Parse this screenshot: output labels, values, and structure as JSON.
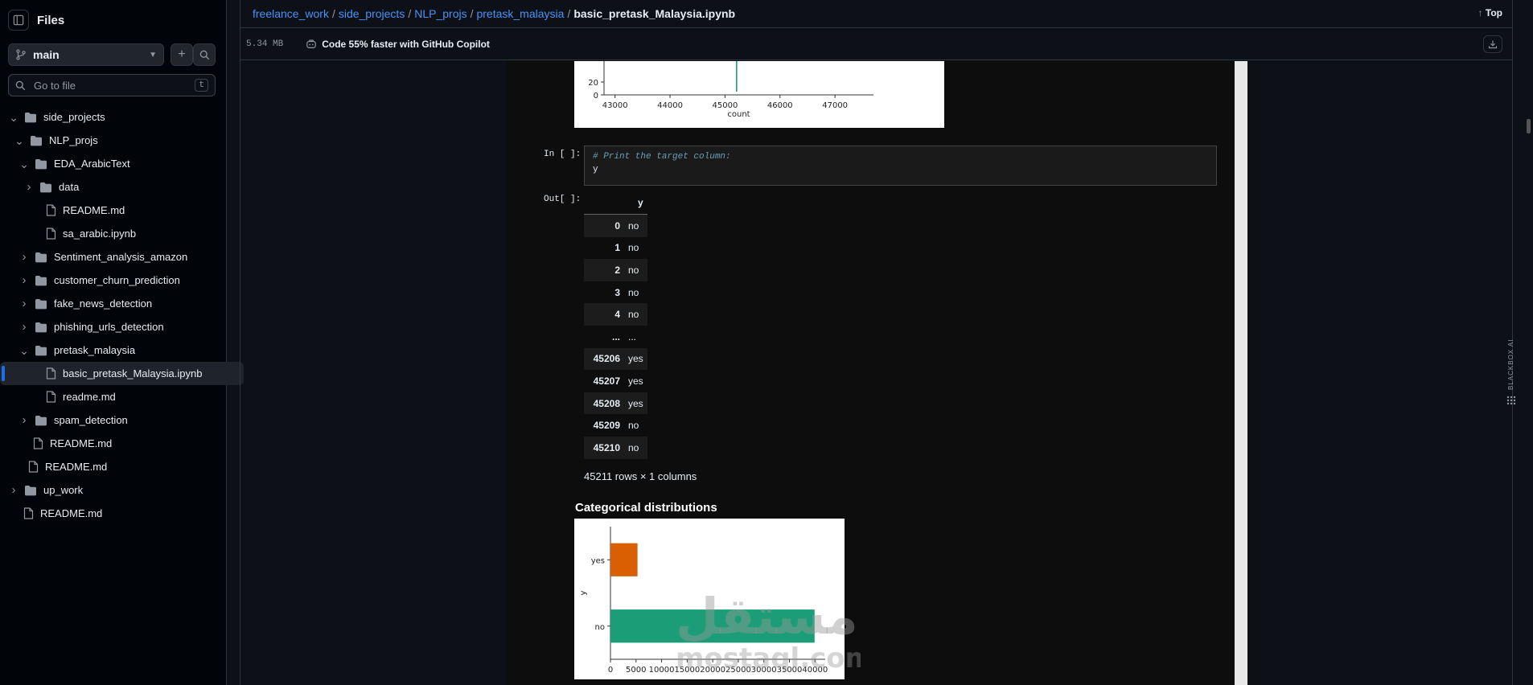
{
  "sidebar": {
    "title": "Files",
    "branch": "main",
    "search_placeholder": "Go to file",
    "search_shortcut": "t",
    "tree": [
      {
        "label": "side_projects",
        "type": "folder",
        "expanded": true
      },
      {
        "label": "NLP_projs",
        "type": "folder",
        "expanded": true
      },
      {
        "label": "EDA_ArabicText",
        "type": "folder",
        "expanded": true
      },
      {
        "label": "data",
        "type": "folder",
        "expanded": false
      },
      {
        "label": "README.md",
        "type": "file"
      },
      {
        "label": "sa_arabic.ipynb",
        "type": "file"
      },
      {
        "label": "Sentiment_analysis_amazon",
        "type": "folder",
        "expanded": false
      },
      {
        "label": "customer_churn_prediction",
        "type": "folder",
        "expanded": false
      },
      {
        "label": "fake_news_detection",
        "type": "folder",
        "expanded": false
      },
      {
        "label": "phishing_urls_detection",
        "type": "folder",
        "expanded": false
      },
      {
        "label": "pretask_malaysia",
        "type": "folder",
        "expanded": true
      },
      {
        "label": "basic_pretask_Malaysia.ipynb",
        "type": "file",
        "selected": true
      },
      {
        "label": "readme.md",
        "type": "file"
      },
      {
        "label": "spam_detection",
        "type": "folder",
        "expanded": false
      },
      {
        "label": "README.md",
        "type": "file"
      },
      {
        "label": "README.md",
        "type": "file"
      },
      {
        "label": "up_work",
        "type": "folder",
        "expanded": false
      },
      {
        "label": "README.md",
        "type": "file"
      }
    ]
  },
  "breadcrumb": {
    "items": [
      "freelance_work",
      "side_projects",
      "NLP_projs",
      "pretask_malaysia"
    ],
    "separator": "/",
    "current": "basic_pretask_Malaysia.ipynb"
  },
  "top_link": "Top",
  "file_info": {
    "size": "5.34 MB",
    "copilot_text": "Code 55% faster with GitHub Copilot"
  },
  "notebook": {
    "in_prompt": "In [ ]:",
    "out_prompt": "Out[ ]:",
    "code_comment": "# Print the target column:",
    "code_line": "y",
    "table": {
      "header": "y",
      "rows": [
        {
          "idx": "0",
          "val": "no"
        },
        {
          "idx": "1",
          "val": "no"
        },
        {
          "idx": "2",
          "val": "no"
        },
        {
          "idx": "3",
          "val": "no"
        },
        {
          "idx": "4",
          "val": "no"
        },
        {
          "idx": "...",
          "val": "..."
        },
        {
          "idx": "45206",
          "val": "yes"
        },
        {
          "idx": "45207",
          "val": "yes"
        },
        {
          "idx": "45208",
          "val": "yes"
        },
        {
          "idx": "45209",
          "val": "no"
        },
        {
          "idx": "45210",
          "val": "no"
        }
      ]
    },
    "shape_text": "45211 rows × 1 columns",
    "section_heading": "Categorical distributions"
  },
  "blackbox_label": "BLACKBOX AI",
  "watermark": "مستقل mostaql.com",
  "chart_data": [
    {
      "type": "bar",
      "orientation": "vertical",
      "xlabel": "count",
      "x_ticks": [
        43000,
        44000,
        45000,
        46000,
        47000
      ],
      "y_ticks_visible": [
        0,
        20
      ],
      "xlim": [
        42800,
        47700
      ],
      "bars": [
        {
          "x": 45211,
          "y": 30
        }
      ],
      "color": "#1a9e77"
    },
    {
      "type": "bar",
      "orientation": "horizontal",
      "ylabel": "y",
      "categories": [
        "yes",
        "no"
      ],
      "values": [
        5289,
        39922
      ],
      "colors": [
        "#d95f02",
        "#1b9e77"
      ],
      "xlim": [
        0,
        42000
      ],
      "x_ticks": [
        0,
        5000,
        10000,
        15000,
        20000,
        25000,
        30000,
        35000,
        40000
      ]
    }
  ]
}
